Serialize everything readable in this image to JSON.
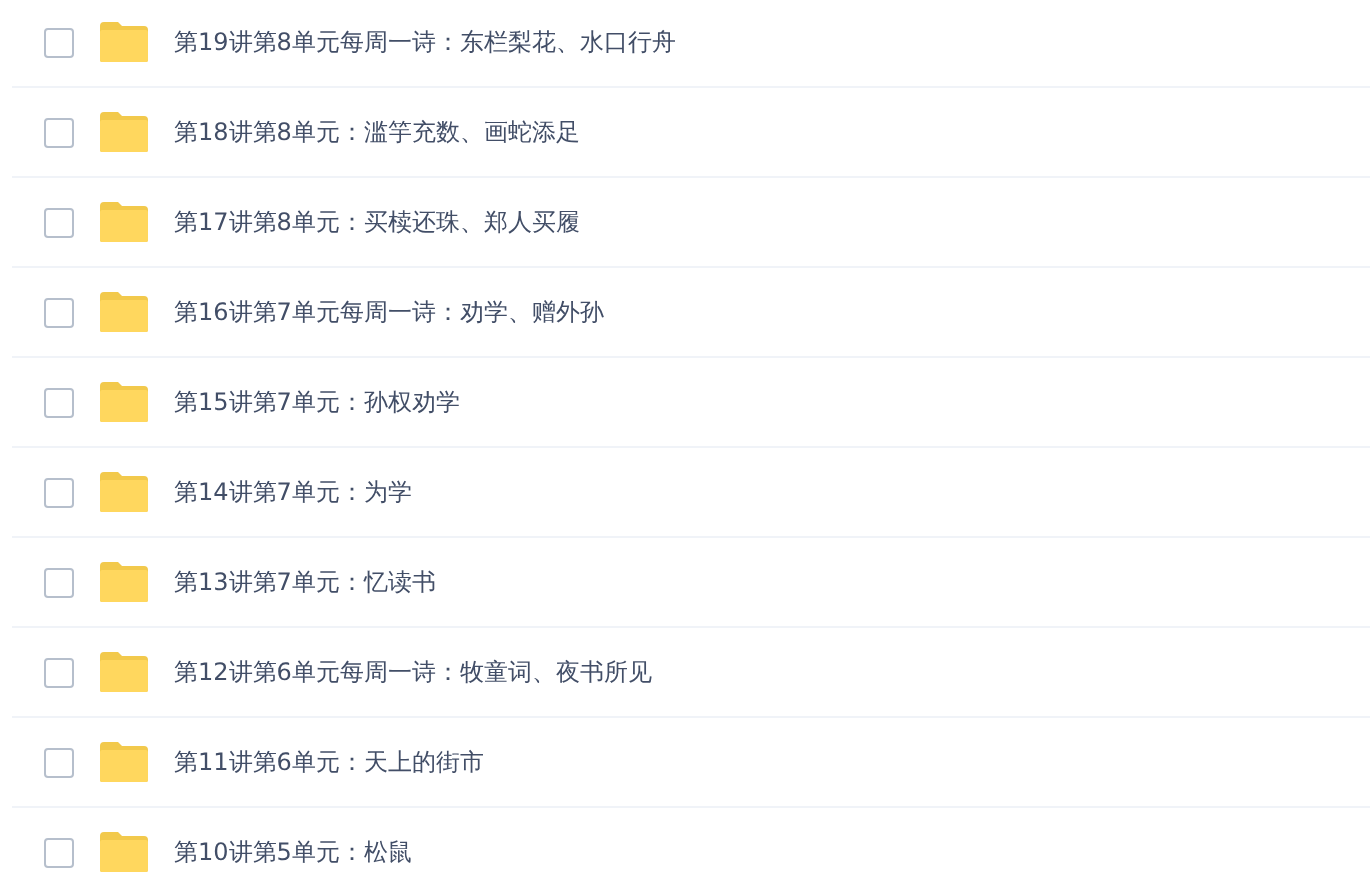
{
  "files": [
    {
      "name": "第19讲第8单元每周一诗：东栏梨花、水口行舟",
      "checked": false
    },
    {
      "name": "第18讲第8单元：滥竽充数、画蛇添足",
      "checked": false
    },
    {
      "name": "第17讲第8单元：买椟还珠、郑人买履",
      "checked": false
    },
    {
      "name": "第16讲第7单元每周一诗：劝学、赠外孙",
      "checked": false
    },
    {
      "name": "第15讲第7单元：孙权劝学",
      "checked": false
    },
    {
      "name": "第14讲第7单元：为学",
      "checked": false
    },
    {
      "name": "第13讲第7单元：忆读书",
      "checked": false
    },
    {
      "name": "第12讲第6单元每周一诗：牧童词、夜书所见",
      "checked": false
    },
    {
      "name": "第11讲第6单元：天上的街市",
      "checked": false
    },
    {
      "name": "第10讲第5单元：松鼠",
      "checked": false
    }
  ]
}
